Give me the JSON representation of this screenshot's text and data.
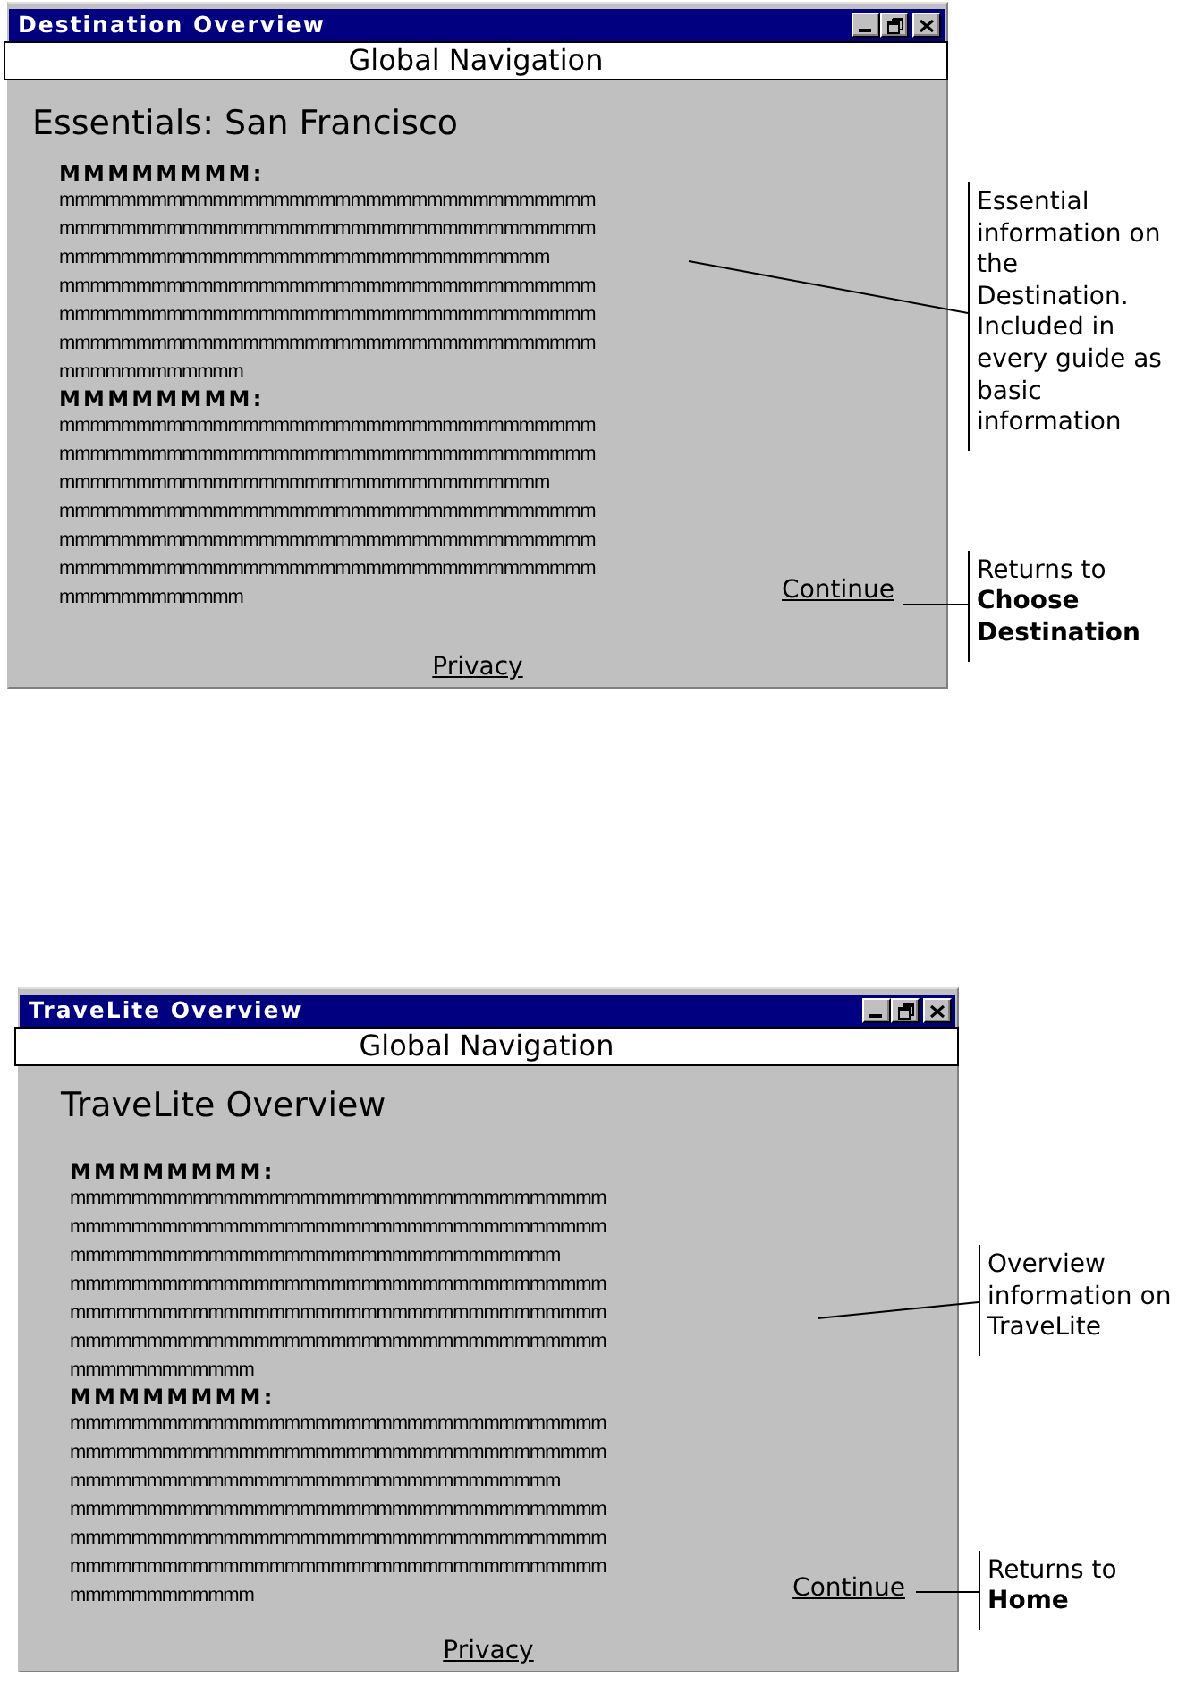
{
  "windows": [
    {
      "title": "Destination Overview",
      "navigation": "Global Navigation",
      "heading": "Essentials: San Francisco",
      "sections": [
        {
          "heading": "MMMMMMMM:",
          "lines": [
            "mmmmmmmmmmmmmmmmmmmmmmmmmmmmmmmmmmm",
            "mmmmmmmmmmmmmmmmmmmmmmmmmmmmmmmmmmm",
            "mmmmmmmmmmmmmmmmmmmmmmmmmmmmmmmm",
            "mmmmmmmmmmmmmmmmmmmmmmmmmmmmmmmmmmm",
            "mmmmmmmmmmmmmmmmmmmmmmmmmmmmmmmmmmm",
            "mmmmmmmmmmmmmmmmmmmmmmmmmmmmmmmmmmm",
            "mmmmmmmmmmmm"
          ]
        },
        {
          "heading": "MMMMMMMM:",
          "lines": [
            "mmmmmmmmmmmmmmmmmmmmmmmmmmmmmmmmmmm",
            "mmmmmmmmmmmmmmmmmmmmmmmmmmmmmmmmmmm",
            "mmmmmmmmmmmmmmmmmmmmmmmmmmmmmmmm",
            "mmmmmmmmmmmmmmmmmmmmmmmmmmmmmmmmmmm",
            "mmmmmmmmmmmmmmmmmmmmmmmmmmmmmmmmmmm",
            "mmmmmmmmmmmmmmmmmmmmmmmmmmmmmmmmmmm",
            "mmmmmmmmmmmm"
          ]
        }
      ],
      "continue_link": "Continue",
      "privacy_link": "Privacy",
      "annotations": [
        "Essential information on the Destination. Included in every guide as basic information",
        "Returns to **Choose Destination**"
      ]
    },
    {
      "title": "TraveLite Overview",
      "navigation": "Global Navigation",
      "heading": "TraveLite Overview",
      "sections": [
        {
          "heading": "MMMMMMMM:",
          "lines": [
            "mmmmmmmmmmmmmmmmmmmmmmmmmmmmmmmmmmm",
            "mmmmmmmmmmmmmmmmmmmmmmmmmmmmmmmmmmm",
            "mmmmmmmmmmmmmmmmmmmmmmmmmmmmmmmm",
            "mmmmmmmmmmmmmmmmmmmmmmmmmmmmmmmmmmm",
            "mmmmmmmmmmmmmmmmmmmmmmmmmmmmmmmmmmm",
            "mmmmmmmmmmmmmmmmmmmmmmmmmmmmmmmmmmm",
            "mmmmmmmmmmmm"
          ]
        },
        {
          "heading": "MMMMMMMM:",
          "lines": [
            "mmmmmmmmmmmmmmmmmmmmmmmmmmmmmmmmmmm",
            "mmmmmmmmmmmmmmmmmmmmmmmmmmmmmmmmmmm",
            "mmmmmmmmmmmmmmmmmmmmmmmmmmmmmmmm",
            "mmmmmmmmmmmmmmmmmmmmmmmmmmmmmmmmmmm",
            "mmmmmmmmmmmmmmmmmmmmmmmmmmmmmmmmmmm",
            "mmmmmmmmmmmmmmmmmmmmmmmmmmmmmmmmmmm",
            "mmmmmmmmmmmm"
          ]
        }
      ],
      "continue_link": "Continue",
      "privacy_link": "Privacy",
      "annotations": [
        "Overview information on TraveLite",
        "Returns to **Home**"
      ]
    }
  ]
}
